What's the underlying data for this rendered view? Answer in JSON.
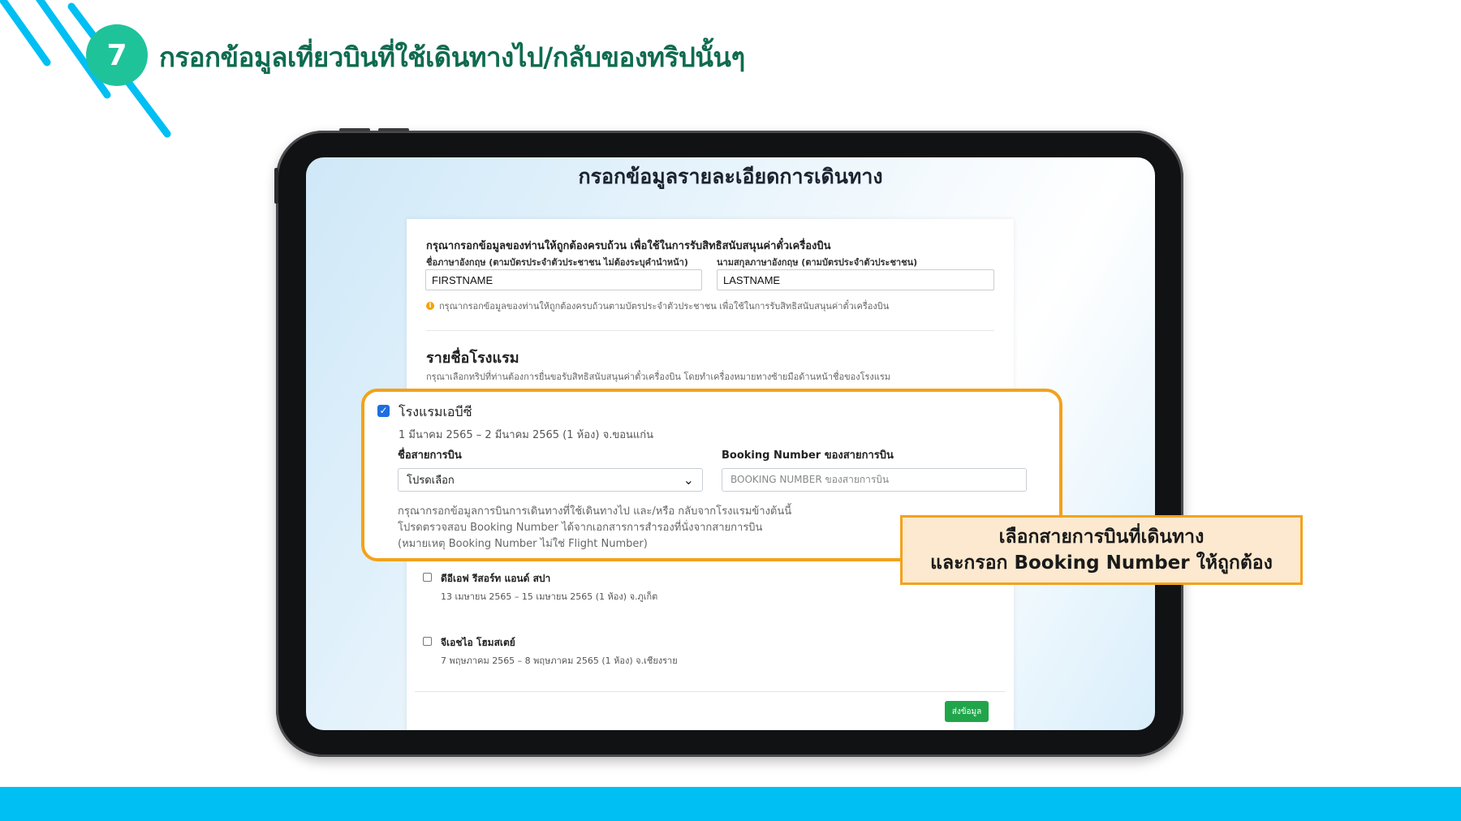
{
  "step": {
    "number": "7",
    "title": "กรอกข้อมูลเที่ยวบินที่ใช้เดินทางไป/กลับของทริปนั้นๆ"
  },
  "screen": {
    "heading": "กรอกข้อมูลรายละเอียดการเดินทาง",
    "instruction": "กรุณากรอกข้อมูลของท่านให้ถูกต้องครบถ้วน เพื่อใช้ในการรับสิทธิสนับสนุนค่าตั๋วเครื่องบิน",
    "firstname_label": "ชื่อภาษาอังกฤษ (ตามบัตรประจำตัวประชาชน ไม่ต้องระบุคำนำหน้า)",
    "firstname_value": "FIRSTNAME",
    "lastname_label": "นามสกุลภาษาอังกฤษ (ตามบัตรประจำตัวประชาชน)",
    "lastname_value": "LASTNAME",
    "note": "กรุณากรอกข้อมูลของท่านให้ถูกต้องครบถ้วนตามบัตรประจำตัวประชาชน เพื่อใช้ในการรับสิทธิสนับสนุนค่าตั๋วเครื่องบิน",
    "hotel_heading": "รายชื่อโรงแรม",
    "hotel_sub": "กรุณาเลือกทริปที่ท่านต้องการยื่นขอรับสิทธิสนับสนุนค่าตั๋วเครื่องบิน โดยทำเครื่องหมายทางซ้ายมือด้านหน้าชื่อของโรงแรม",
    "hotels": [
      {
        "name": "ดีอีเอฟ รีสอร์ท แอนด์ สปา",
        "date": "13 เมษายน 2565 – 15 เมษายน 2565 (1 ห้อง) จ.ภูเก็ต"
      },
      {
        "name": "จีเอชไอ โฮมสเตย์",
        "date": "7 พฤษภาคม 2565 – 8 พฤษภาคม 2565 (1 ห้อง) จ.เชียงราย"
      }
    ],
    "submit_label": "ส่งข้อมูล"
  },
  "selected_hotel": {
    "checked_glyph": "✓",
    "name": "โรงแรมเอบีซี",
    "date": "1 มีนาคม 2565 – 2 มีนาคม 2565 (1 ห้อง) จ.ขอนแก่น",
    "airline_label": "ชื่อสายการบิน",
    "airline_value": "โปรดเลือก",
    "booking_label": "Booking Number ของสายการบิน",
    "booking_placeholder": "BOOKING NUMBER ของสายการบิน",
    "help_lines": [
      "กรุณากรอกข้อมูลการบินการเดินทางที่ใช้เดินทางไป และ/หรือ กลับจากโรงแรมข้างต้นนี้",
      "โปรดตรวจสอบ Booking Number ได้จากเอกสารการสำรองที่นั่งจากสายการบิน",
      "(หมายเหตุ Booking Number ไม่ใช่ Flight Number)"
    ]
  },
  "callout": {
    "line1": "เลือกสายการบินที่เดินทาง",
    "line2": "และกรอก Booking Number ให้ถูกต้อง"
  },
  "colors": {
    "step_badge": "#1fc39a",
    "title_green": "#0f6b4f",
    "band_blue": "#00bff3",
    "highlight_orange": "#f3a21c",
    "callout_fill": "#fde9cf",
    "submit_green": "#21a54a"
  },
  "icons": {
    "chevron": "⌄",
    "info": "i"
  }
}
